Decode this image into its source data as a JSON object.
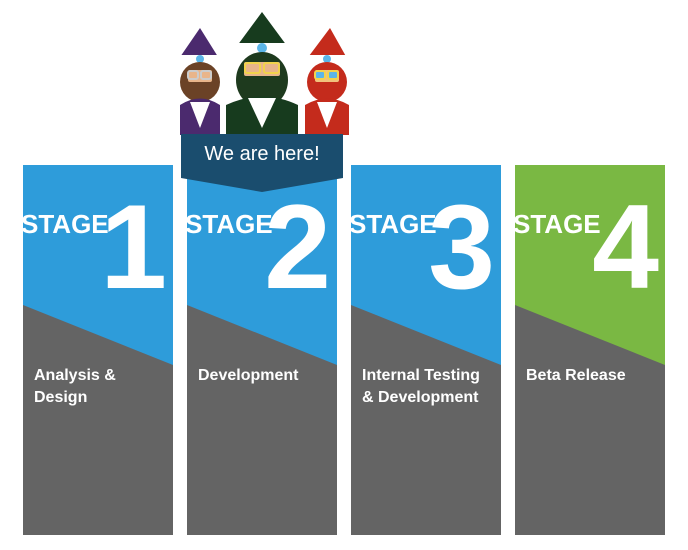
{
  "banner": {
    "label": "We are here!"
  },
  "colors": {
    "blue": "#2E9CDA",
    "green": "#7AB843",
    "gray": "#646464",
    "banner": "#1A4D6E"
  },
  "stages": [
    {
      "word": "STAGE",
      "number": "1",
      "description": "Analysis & Design",
      "color": "#2E9CDA"
    },
    {
      "word": "STAGE",
      "number": "2",
      "description": "Development",
      "color": "#2E9CDA"
    },
    {
      "word": "STAGE",
      "number": "3",
      "description": "Internal Testing & Development",
      "color": "#2E9CDA"
    },
    {
      "word": "STAGE",
      "number": "4",
      "description": "Beta Release",
      "color": "#7AB843"
    }
  ],
  "mascots": [
    {
      "name": "purple-gnome-icon",
      "color": "#4B2A6E"
    },
    {
      "name": "green-gnome-icon",
      "color": "#173B1E"
    },
    {
      "name": "red-gnome-icon",
      "color": "#C42B1C"
    }
  ]
}
